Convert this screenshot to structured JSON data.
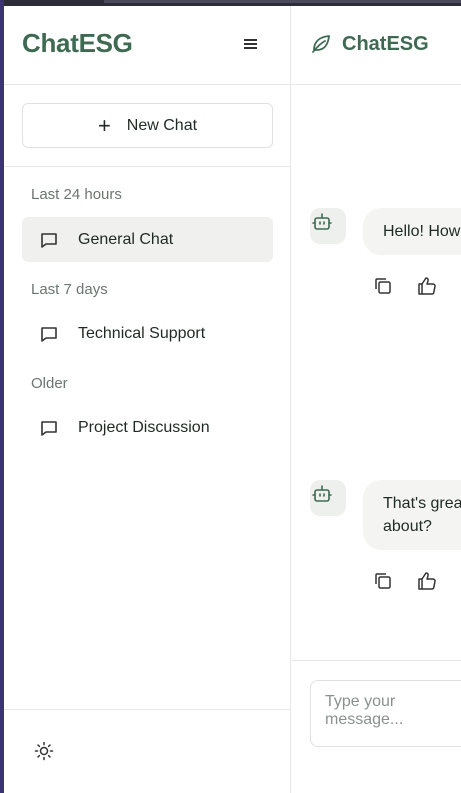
{
  "sidebar": {
    "brand": "ChatESG",
    "menu_icon": "hamburger-menu-icon",
    "new_chat_label": "New Chat",
    "sections": [
      {
        "label": "Last 24 hours",
        "items": [
          {
            "label": "General Chat",
            "active": true
          }
        ]
      },
      {
        "label": "Last 7 days",
        "items": [
          {
            "label": "Technical Support",
            "active": false
          }
        ]
      },
      {
        "label": "Older",
        "items": [
          {
            "label": "Project Discussion",
            "active": false
          }
        ]
      }
    ],
    "theme_icon": "sun-icon"
  },
  "main": {
    "title": "ChatESG",
    "logo_icon": "leaf-icon",
    "messages": [
      {
        "role": "assistant",
        "lines": [
          "Hello! How"
        ]
      },
      {
        "role": "assistant",
        "lines": [
          "That's grea",
          "about?"
        ]
      }
    ],
    "composer": {
      "placeholder": "Type your message..."
    }
  },
  "colors": {
    "brand": "#3e6a52",
    "active_item_bg": "#f0f1ef",
    "bubble_bg": "#f4f5f3"
  }
}
